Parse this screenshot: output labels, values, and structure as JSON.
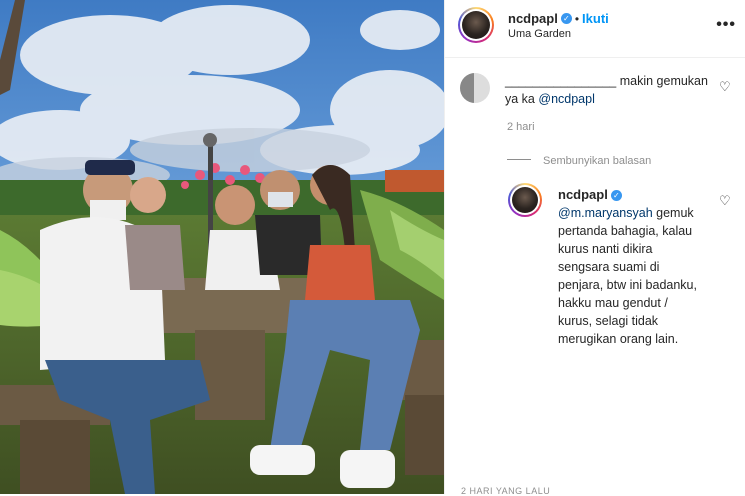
{
  "post": {
    "username": "ncdpapl",
    "follow_label": "Ikuti",
    "location": "Uma Garden",
    "more_icon": "more-horizontal-icon"
  },
  "comment": {
    "redacted_username": "________________",
    "text_part1": "makin gemukan",
    "text_part2": "ya ka",
    "mention": "@ncdpapl",
    "time": "2 hari"
  },
  "toggle_replies": "Sembunyikan balasan",
  "reply": {
    "username": "ncdpapl",
    "mention": "@m.maryansyah",
    "line1": "gemuk",
    "line2": "pertanda bahagia, kalau",
    "line3": "kurus nanti dikira",
    "line4": "sengsara suami di",
    "line5": "penjara, btw ini badanku,",
    "line6": "hakku mau gendut /",
    "line7": "kurus, selagi tidak",
    "line8": "merugikan orang lain."
  },
  "footer_time": "2 HARI YANG LALU",
  "colors": {
    "accent": "#0095f6",
    "verified": "#3897f0",
    "muted": "#8e8e8e"
  }
}
